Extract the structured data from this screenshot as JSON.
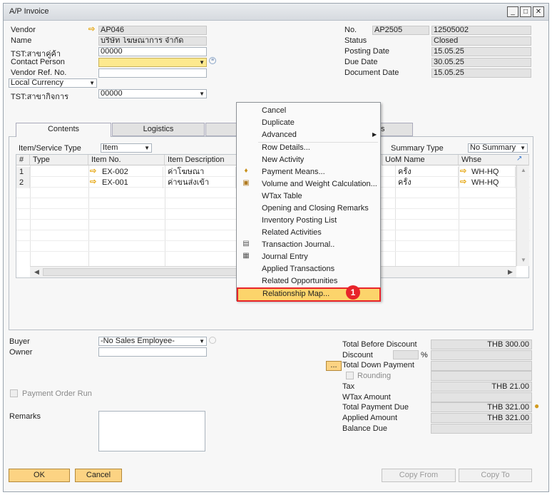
{
  "window": {
    "title": "A/P Invoice"
  },
  "header_left": {
    "vendor_label": "Vendor",
    "vendor_value": "AP046",
    "name_label": "Name",
    "name_value": "บริษัท โฆษณาการ จำกัด",
    "branch_label": "TST:สาขาคู่ค้า",
    "branch_value": "00000",
    "contact_label": "Contact Person",
    "contact_value": "",
    "ref_label": "Vendor Ref. No.",
    "ref_value": "",
    "currency_value": "Local Currency",
    "biz_branch_label": "TST:สาขากิจการ",
    "biz_branch_value": "00000"
  },
  "header_right": {
    "no_label": "No.",
    "no_series": "AP2505",
    "no_value": "12505002",
    "status_label": "Status",
    "status_value": "Closed",
    "posting_label": "Posting Date",
    "posting_value": "15.05.25",
    "due_label": "Due Date",
    "due_value": "30.05.25",
    "doc_label": "Document Date",
    "doc_value": "15.05.25"
  },
  "tabs": [
    "Contents",
    "Logistics",
    "s"
  ],
  "contents": {
    "item_type_label": "Item/Service Type",
    "item_type_value": "Item",
    "summary_type_label": "Summary Type",
    "summary_type_value": "No Summary",
    "columns": [
      "#",
      "Type",
      "Item No.",
      "Item Description",
      "UoM Name",
      "Whse"
    ],
    "rows": [
      {
        "num": "1",
        "item_no": "EX-002",
        "desc": "ค่าโฆษณา",
        "uom": "ครั้ง",
        "whse": "WH-HQ"
      },
      {
        "num": "2",
        "item_no": "EX-001",
        "desc": "ค่าขนส่งเข้า",
        "uom": "ครั้ง",
        "whse": "WH-HQ"
      }
    ]
  },
  "context_menu": {
    "items": [
      {
        "label": "Cancel",
        "icon": ""
      },
      {
        "label": "Duplicate",
        "icon": ""
      },
      {
        "label": "Advanced",
        "icon": "submenu-arrow"
      },
      {
        "label": "Row Details...",
        "icon": ""
      },
      {
        "label": "New Activity",
        "icon": ""
      },
      {
        "label": "Payment Means...",
        "icon": "payment-icon"
      },
      {
        "label": "Volume and Weight Calculation...",
        "icon": "volume-icon"
      },
      {
        "label": "WTax Table",
        "icon": ""
      },
      {
        "label": "Opening and Closing Remarks",
        "icon": ""
      },
      {
        "label": "Inventory Posting List",
        "icon": ""
      },
      {
        "label": "Related Activities",
        "icon": ""
      },
      {
        "label": "Transaction Journal..",
        "icon": "journal-icon"
      },
      {
        "label": "Journal Entry",
        "icon": "journal-entry-icon"
      },
      {
        "label": "Applied Transactions",
        "icon": ""
      },
      {
        "label": "Related Opportunities",
        "icon": ""
      },
      {
        "label": "Relationship Map...",
        "icon": ""
      }
    ],
    "highlight_badge": "1",
    "highlight_color": "#e8242a"
  },
  "footer_left": {
    "buyer_label": "Buyer",
    "buyer_value": "-No Sales Employee-",
    "owner_label": "Owner",
    "owner_value": "",
    "payment_order_label": "Payment Order Run",
    "remarks_label": "Remarks"
  },
  "totals": {
    "before_discount_label": "Total Before Discount",
    "before_discount_value": "THB 300.00",
    "discount_label": "Discount",
    "discount_pct": "%",
    "down_payment_label": "Total Down Payment",
    "rounding_label": "Rounding",
    "tax_label": "Tax",
    "tax_value": "THB 21.00",
    "wtax_label": "WTax Amount",
    "payment_due_label": "Total Payment Due",
    "payment_due_value": "THB 321.00",
    "applied_label": "Applied Amount",
    "applied_value": "THB 321.00",
    "balance_label": "Balance Due",
    "ellipsis": "..."
  },
  "buttons": {
    "ok": "OK",
    "cancel": "Cancel",
    "copy_from": "Copy From",
    "copy_to": "Copy To"
  }
}
